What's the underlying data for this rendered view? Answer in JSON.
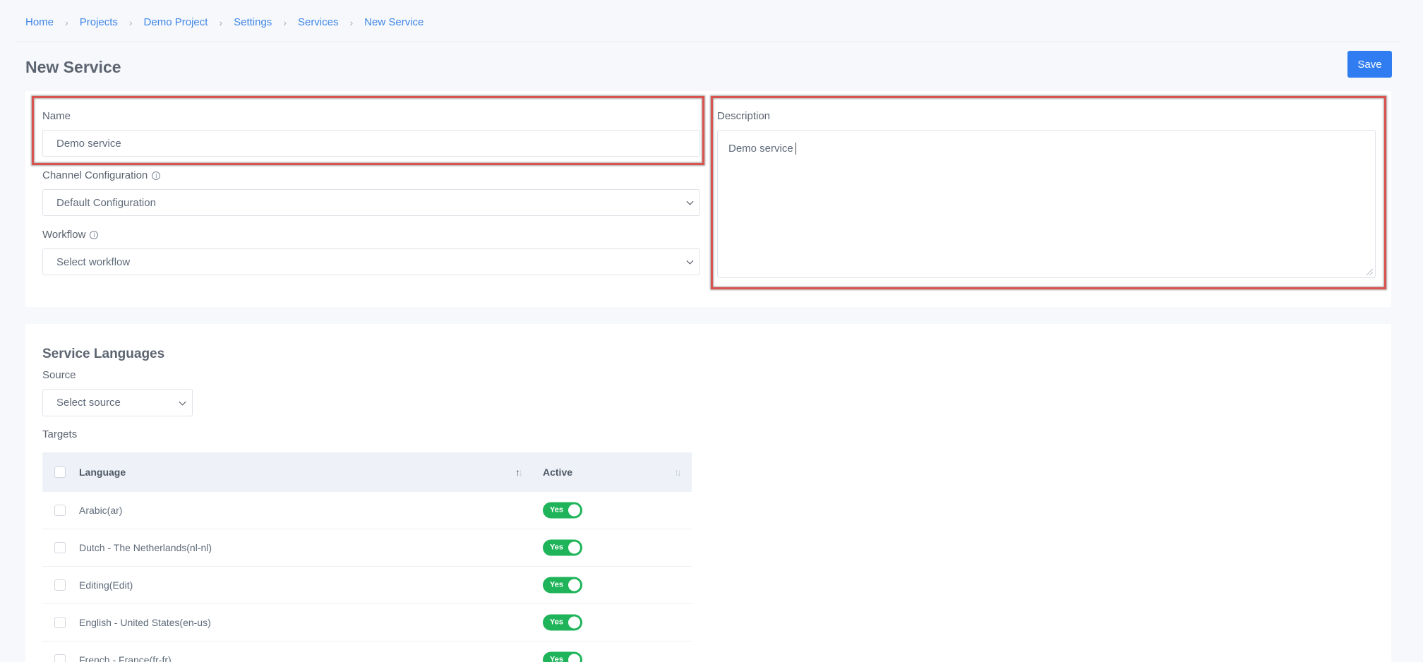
{
  "breadcrumb": [
    "Home",
    "Projects",
    "Demo Project",
    "Settings",
    "Services",
    "New Service"
  ],
  "page_title": "New Service",
  "save_label": "Save",
  "form": {
    "name_label": "Name",
    "name_value": "Demo service",
    "channel_label": "Channel Configuration",
    "channel_value": "Default Configuration",
    "workflow_label": "Workflow",
    "workflow_value": "Select workflow",
    "description_label": "Description",
    "description_value": "Demo service"
  },
  "languages": {
    "title": "Service Languages",
    "source_label": "Source",
    "source_value": "Select source",
    "targets_label": "Targets",
    "col_language": "Language",
    "col_active": "Active",
    "rows": [
      {
        "language": "Arabic(ar)",
        "active": "Yes"
      },
      {
        "language": "Dutch - The Netherlands(nl-nl)",
        "active": "Yes"
      },
      {
        "language": "Editing(Edit)",
        "active": "Yes"
      },
      {
        "language": "English - United States(en-us)",
        "active": "Yes"
      },
      {
        "language": "French - France(fr-fr)",
        "active": "Yes"
      }
    ]
  },
  "colors": {
    "accent": "#2f7df0",
    "link": "#3f86e6",
    "toggle_on": "#1fb45a",
    "highlight": "#d9534f"
  },
  "icons": {
    "breadcrumb_separator": "chevron-right-icon",
    "info": "info-icon",
    "select": "chevron-down-icon",
    "sort": "sort-icon"
  }
}
